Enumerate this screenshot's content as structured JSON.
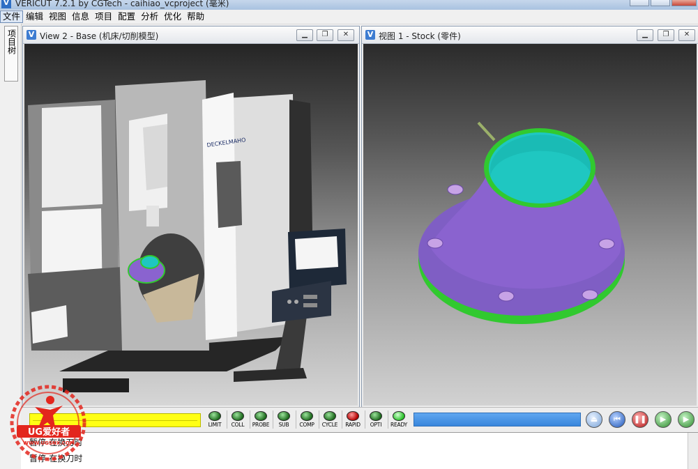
{
  "app": {
    "title": "VERICUT 7.2.1 by CGTech - caihiao_vcproject (毫米)",
    "icon_letter": "V"
  },
  "menu": [
    {
      "label": "文件",
      "active": true
    },
    {
      "label": "编辑"
    },
    {
      "label": "视图"
    },
    {
      "label": "信息"
    },
    {
      "label": "项目"
    },
    {
      "label": "配置"
    },
    {
      "label": "分析"
    },
    {
      "label": "优化"
    },
    {
      "label": "帮助"
    }
  ],
  "sidebar": {
    "tab_label": "项目树"
  },
  "views": [
    {
      "title": "View 2 - Base (机床/切削模型)",
      "machine_brand": "DECKELMAHO",
      "buttons": [
        "minimize",
        "restore",
        "close"
      ]
    },
    {
      "title": "视图 1 - Stock (零件)",
      "buttons": [
        "minimize",
        "restore",
        "close"
      ]
    }
  ],
  "status": {
    "progress_left_fraction": 1.0,
    "progress_right_fraction": 1.0,
    "leds": [
      {
        "label": "LIMIT",
        "color": "green"
      },
      {
        "label": "COLL",
        "color": "green"
      },
      {
        "label": "PROBE",
        "color": "green"
      },
      {
        "label": "SUB",
        "color": "green"
      },
      {
        "label": "COMP",
        "color": "green"
      },
      {
        "label": "CYCLE",
        "color": "green"
      },
      {
        "label": "RAPID",
        "color": "red"
      },
      {
        "label": "OPTI",
        "color": "green"
      },
      {
        "label": "READY",
        "color": "bright-green"
      }
    ],
    "controls": [
      {
        "name": "eject-icon"
      },
      {
        "name": "rewind-icon"
      },
      {
        "name": "pause-icon"
      },
      {
        "name": "step-forward-icon"
      },
      {
        "name": "play-icon"
      }
    ]
  },
  "messages": [
    "暂停-在换刀时",
    "暂停-在换刀时"
  ],
  "watermark": {
    "text": "UG爱好者",
    "url": "WWW.UGSNX.COM"
  },
  "colors": {
    "part_body": "#8a63cf",
    "part_flange_edge": "#31c92f",
    "part_bore": "#1fc7c1",
    "progress_left": "#ffff14",
    "progress_right": "#3f8de2"
  }
}
